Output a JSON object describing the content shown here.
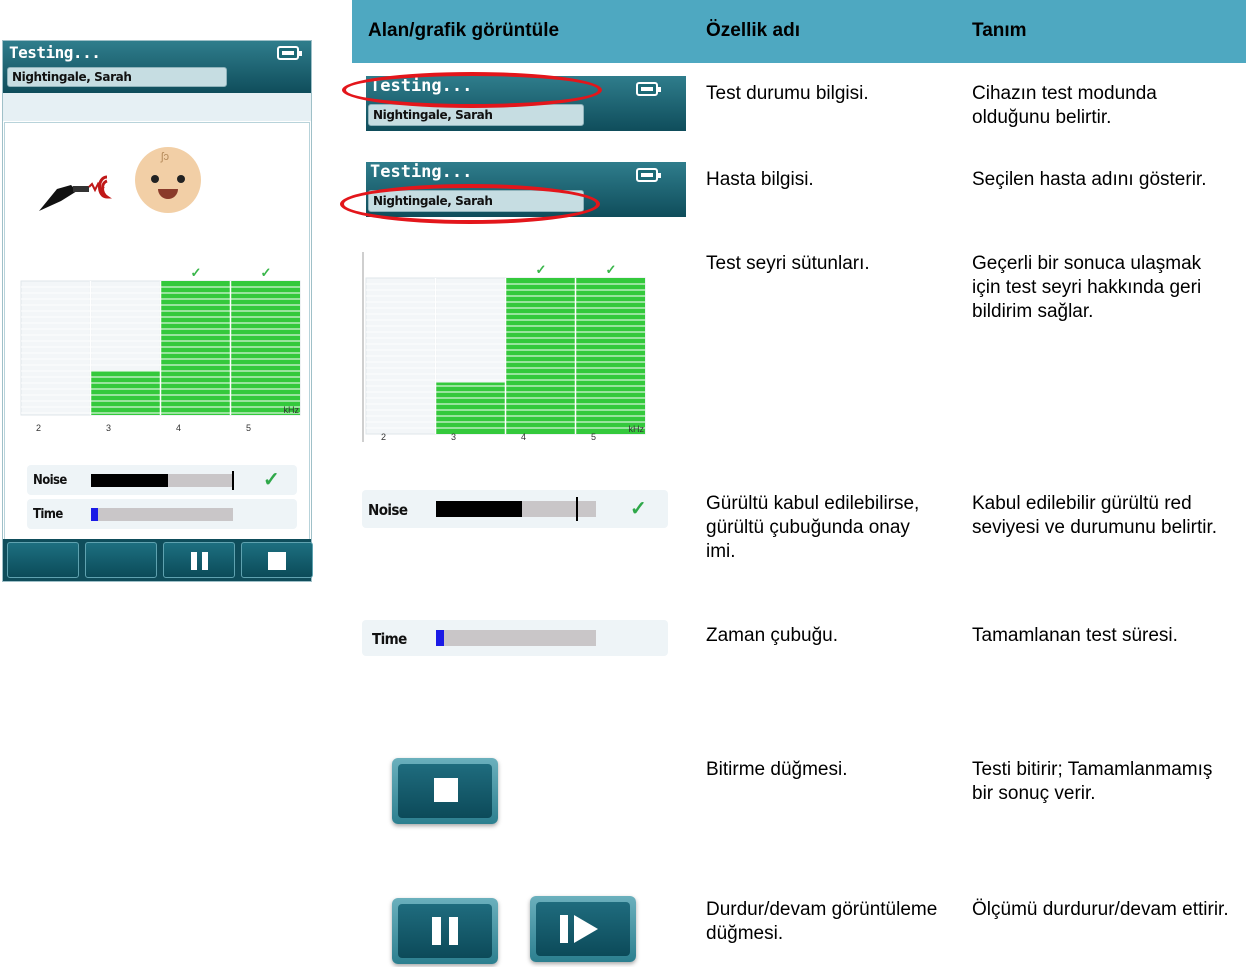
{
  "device": {
    "title": "Testing...",
    "patient": "Nightingale, Sarah",
    "chart": {
      "unit": "kHz",
      "ticks": [
        "2",
        "3",
        "4",
        "5"
      ]
    },
    "noise_label": "Noise",
    "time_label": "Time",
    "buttons": [
      "blank",
      "blank",
      "pause",
      "stop"
    ]
  },
  "table": {
    "headers": [
      "Alan/grafik görüntüle",
      "Özellik adı",
      "Tanım"
    ],
    "rows": [
      {
        "feature": "Test durumu bilgisi.",
        "description": " Cihazın test modunda olduğunu belirtir.",
        "thumb": {
          "title": "Testing...",
          "patient": "Nightingale, Sarah"
        }
      },
      {
        "feature": "Hasta bilgisi.",
        "description": "Seçilen hasta adını gösterir.",
        "thumb": {
          "title": "Testing...",
          "patient": "Nightingale, Sarah"
        }
      },
      {
        "feature": "Test seyri sütunları.",
        "description": "Geçerli bir sonuca ulaşmak için test seyri hakkında geri bildirim sağlar.",
        "chart_ticks": [
          "2",
          "3",
          "4",
          "5"
        ],
        "chart_unit": "kHz"
      },
      {
        "feature": "Gürültü kabul edilebilirse, gürültü çubuğunda onay imi.",
        "description": "Kabul edilebilir gürültü red seviyesi ve durumunu belirtir.",
        "label": "Noise"
      },
      {
        "feature": "Zaman çubuğu.",
        "description": "Tamamlanan test süresi.",
        "label": "Time"
      },
      {
        "feature": "Bitirme düğmesi.",
        "description": "Testi bitirir; Tamamlanmamış bir sonuç verir."
      },
      {
        "feature": "Durdur/devam görüntüleme düğmesi.",
        "description": "Ölçümü durdurur/devam ettirir."
      }
    ]
  },
  "colors": {
    "header_teal": "#4ea8c1",
    "device_teal": "#0f4d5b",
    "progress_green": "#34c93c",
    "check_green": "#39b64a",
    "highlight_red": "#e3161b",
    "time_blue": "#1a1ae6"
  },
  "chart_data": {
    "type": "bar",
    "categories": [
      "2",
      "3",
      "4",
      "5"
    ],
    "values": [
      0,
      0.33,
      1,
      1
    ],
    "passed": [
      false,
      false,
      true,
      true
    ],
    "xlabel": "kHz",
    "ylim": [
      0,
      1
    ]
  },
  "bars": {
    "noise_level": 0.54,
    "noise_threshold": 0.99,
    "time_progress": 0.05
  }
}
